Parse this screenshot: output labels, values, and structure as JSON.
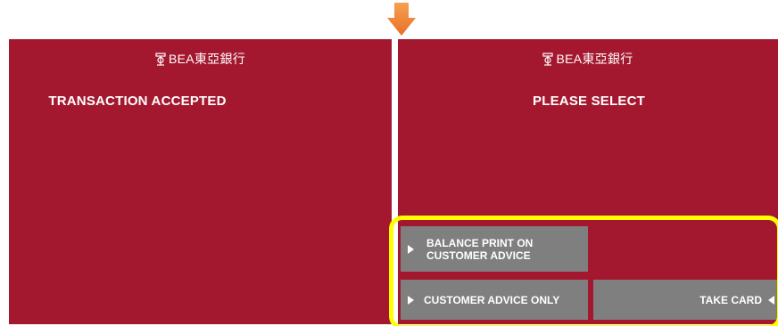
{
  "colors": {
    "screen_background": "#a4182f",
    "softkey_background": "#7f7f7f",
    "highlight_border": "#ffff00",
    "arrow": "#f07b2b"
  },
  "icons": {
    "step_arrow": "down-arrow-icon",
    "bank_seal": "bea-seal-icon",
    "softkey_left_pointer": "triangle-right-icon",
    "softkey_right_pointer": "triangle-left-icon"
  },
  "left_screen": {
    "logo_text": "BEA東亞銀行",
    "heading": "TRANSACTION ACCEPTED"
  },
  "right_screen": {
    "logo_text": "BEA東亞銀行",
    "heading": "PLEASE SELECT",
    "options": {
      "balance_print_line1": "BALANCE PRINT ON",
      "balance_print_line2": "CUSTOMER ADVICE",
      "customer_advice_only": "CUSTOMER ADVICE ONLY",
      "take_card": "TAKE CARD"
    }
  }
}
